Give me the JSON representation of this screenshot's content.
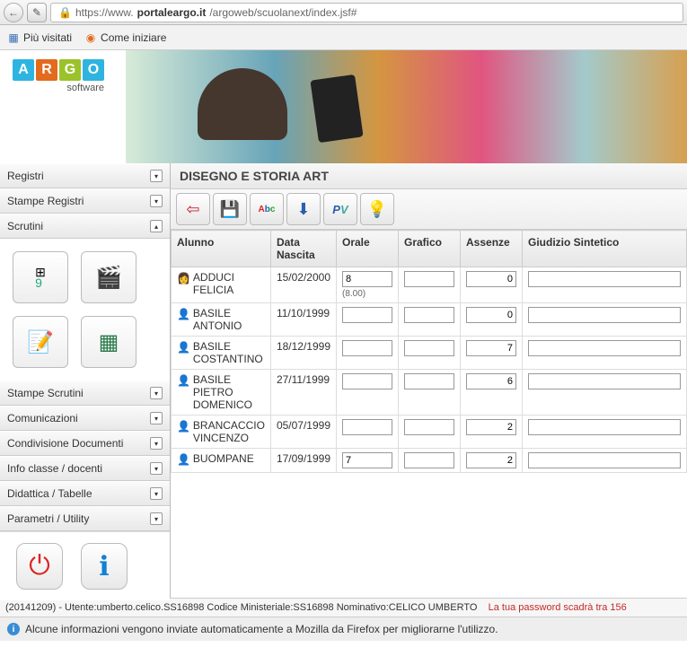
{
  "browser": {
    "url_prefix": "https://www.",
    "url_domain": "portaleargo.it",
    "url_path": "/argoweb/scuolanext/index.jsf#"
  },
  "bookmarks": {
    "most_visited": "Più visitati",
    "getting_started": "Come iniziare"
  },
  "logo": {
    "sub": "software"
  },
  "sidebar": {
    "registri": "Registri",
    "stampe_registri": "Stampe Registri",
    "scrutini": "Scrutini",
    "stampe_scrutini": "Stampe Scrutini",
    "comunicazioni": "Comunicazioni",
    "condivisione": "Condivisione Documenti",
    "info_classe": "Info classe / docenti",
    "didattica": "Didattica / Tabelle",
    "parametri": "Parametri / Utility"
  },
  "content": {
    "title": "DISEGNO E STORIA ART",
    "headers": {
      "alunno": "Alunno",
      "data_nascita": "Data Nascita",
      "orale": "Orale",
      "grafico": "Grafico",
      "assenze": "Assenze",
      "giudizio": "Giudizio Sintetico"
    },
    "rows": [
      {
        "name": "ADDUCI FELICIA",
        "gender": "f",
        "dob": "15/02/2000",
        "orale": "8",
        "orale_sub": "(8.00)",
        "grafico": "",
        "assenze": "0",
        "giudizio": ""
      },
      {
        "name": "BASILE ANTONIO",
        "gender": "m",
        "dob": "11/10/1999",
        "orale": "",
        "orale_sub": "",
        "grafico": "",
        "assenze": "0",
        "giudizio": ""
      },
      {
        "name": "BASILE COSTANTINO",
        "gender": "m",
        "dob": "18/12/1999",
        "orale": "",
        "orale_sub": "",
        "grafico": "",
        "assenze": "7",
        "giudizio": ""
      },
      {
        "name": "BASILE PIETRO DOMENICO",
        "gender": "m",
        "dob": "27/11/1999",
        "orale": "",
        "orale_sub": "",
        "grafico": "",
        "assenze": "6",
        "giudizio": ""
      },
      {
        "name": "BRANCACCIO VINCENZO",
        "gender": "m",
        "dob": "05/07/1999",
        "orale": "",
        "orale_sub": "",
        "grafico": "",
        "assenze": "2",
        "giudizio": ""
      },
      {
        "name": "BUOMPANE",
        "gender": "m",
        "dob": "17/09/1999",
        "orale": "7",
        "orale_sub": "",
        "grafico": "",
        "assenze": "2",
        "giudizio": ""
      }
    ]
  },
  "footer": {
    "status": "(20141209) - Utente:umberto.celico.SS16898 Codice Ministeriale:SS16898 Nominativo:CELICO UMBERTO",
    "warn": "La tua password scadrà tra 156",
    "info": "Alcune informazioni vengono inviate automaticamente a Mozilla da Firefox per migliorarne l'utilizzo."
  }
}
